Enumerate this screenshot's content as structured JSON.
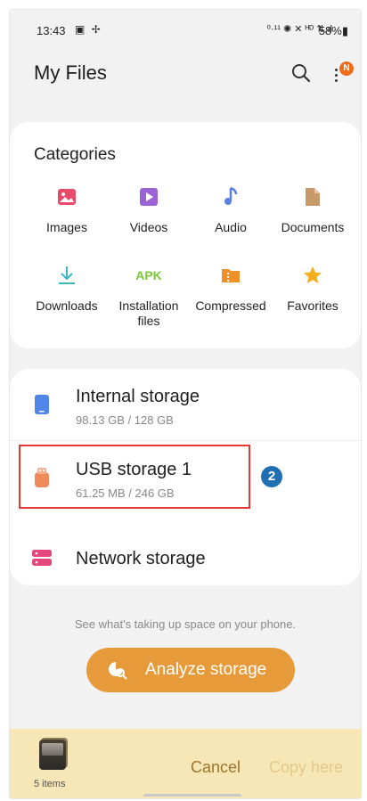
{
  "status_bar": {
    "time": "13:43",
    "left_icons": "▣ ✢",
    "right_icons": "⁰·¹¹ ✺ ✕ ᴴᴰ ⇅.ıl",
    "battery": "58%"
  },
  "header": {
    "title": "My Files",
    "notification_badge": "N"
  },
  "categories": {
    "title": "Categories",
    "items": [
      {
        "label": "Images",
        "icon": "image-icon",
        "color": "#e84a6a"
      },
      {
        "label": "Videos",
        "icon": "video-icon",
        "color": "#9b63d6"
      },
      {
        "label": "Audio",
        "icon": "music-note-icon",
        "color": "#5b7fe0"
      },
      {
        "label": "Documents",
        "icon": "document-icon",
        "color": "#c89a6a"
      },
      {
        "label": "Downloads",
        "icon": "download-icon",
        "color": "#3bb8c4"
      },
      {
        "label": "Installation files",
        "icon": "apk-icon",
        "icon_text": "APK",
        "color": "#7cc93a"
      },
      {
        "label": "Compressed",
        "icon": "zip-icon",
        "color": "#f0902a"
      },
      {
        "label": "Favorites",
        "icon": "star-icon",
        "color": "#f2b01e"
      }
    ]
  },
  "storage": [
    {
      "name": "Internal storage",
      "usage": "98.13 GB / 128 GB",
      "icon": "phone-icon",
      "color": "#4f86e8"
    },
    {
      "name": "USB storage 1",
      "usage": "61.25 MB / 246 GB",
      "icon": "usb-drive-icon",
      "color": "#f08a5a"
    },
    {
      "name": "Network storage",
      "usage": "",
      "icon": "network-storage-icon",
      "color": "#e5487a"
    }
  ],
  "annotation": {
    "step": "2",
    "color": "#e53935"
  },
  "hint": "See what's taking up space on your phone.",
  "analyze_button": "Analyze storage",
  "bottom_bar": {
    "items_count": "5 items",
    "cancel": "Cancel",
    "copy_here": "Copy here"
  }
}
